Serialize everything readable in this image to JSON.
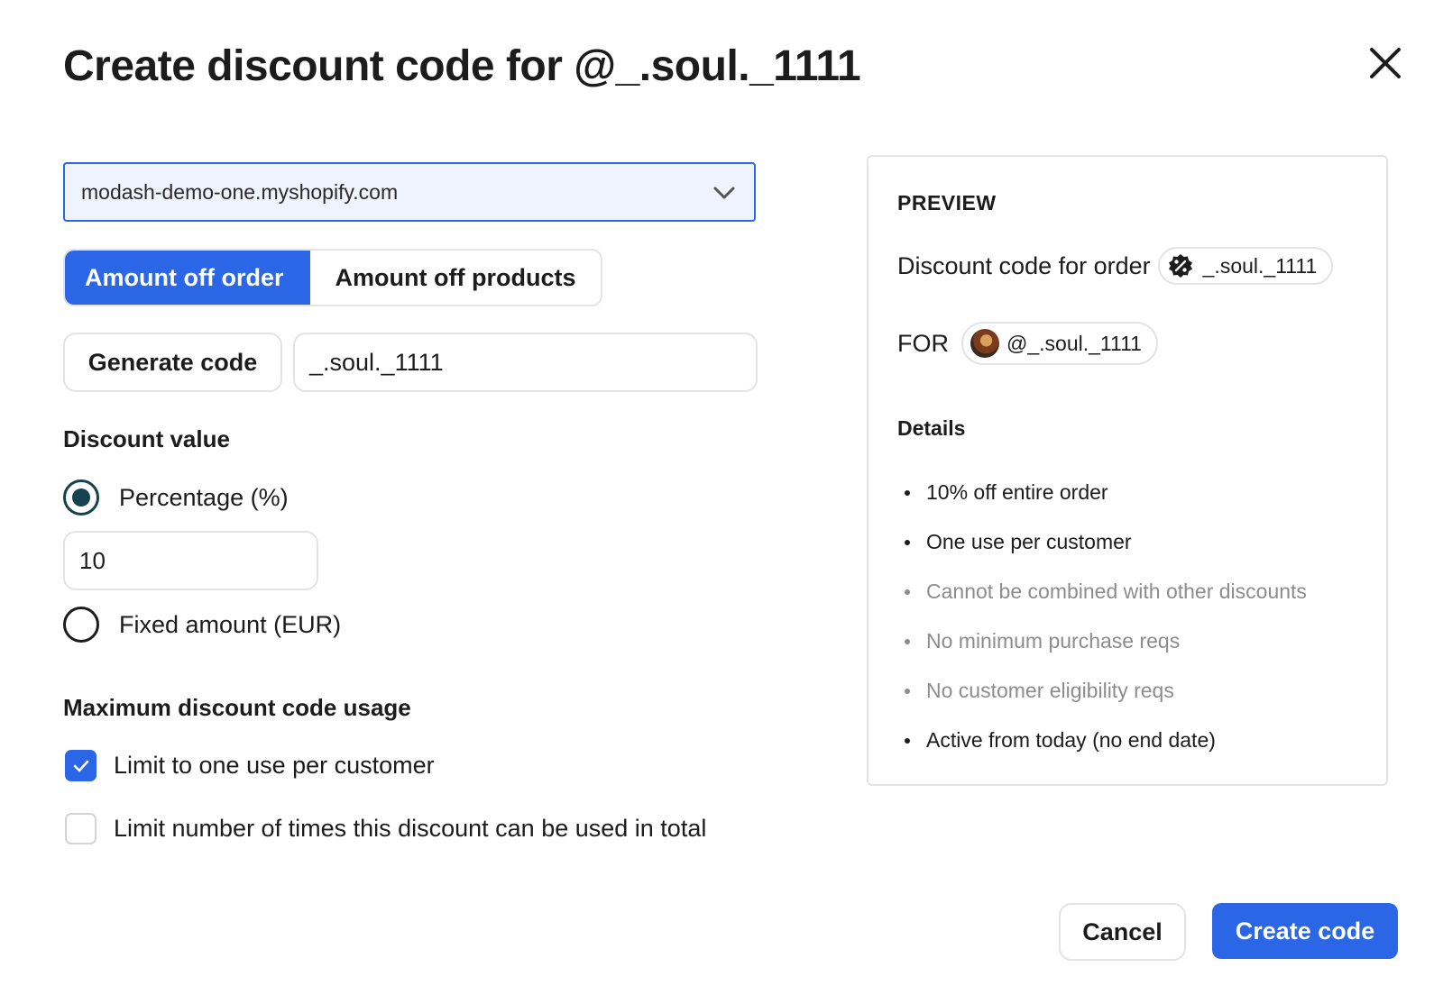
{
  "modal": {
    "title": "Create discount code for @_.soul._1111",
    "close_icon": "close-icon"
  },
  "store_select": {
    "value": "modash-demo-one.myshopify.com",
    "icon": "chevron-down-icon"
  },
  "discount_type_tabs": [
    {
      "label": "Amount off order",
      "selected": true
    },
    {
      "label": "Amount off products",
      "selected": false
    }
  ],
  "code": {
    "generate_label": "Generate code",
    "value": "_.soul._1111"
  },
  "discount_value": {
    "heading": "Discount value",
    "percentage_label": "Percentage (%)",
    "percentage_selected": true,
    "percentage_value": "10",
    "fixed_label": "Fixed amount (EUR)",
    "fixed_selected": false
  },
  "usage": {
    "heading": "Maximum discount code usage",
    "one_per_customer_label": "Limit to one use per customer",
    "one_per_customer_checked": true,
    "total_limit_label": "Limit number of times this discount can be used in total",
    "total_limit_checked": false
  },
  "preview": {
    "heading": "PREVIEW",
    "code_label": "Discount code for order",
    "code_chip": "_.soul._1111",
    "code_chip_icon": "discount-badge-icon",
    "for_label": "FOR",
    "for_chip": "@_.soul._1111",
    "details_heading": "Details",
    "details": [
      {
        "text": "10% off entire order",
        "muted": false
      },
      {
        "text": "One use per customer",
        "muted": false
      },
      {
        "text": "Cannot be combined with other discounts",
        "muted": true
      },
      {
        "text": "No minimum purchase reqs",
        "muted": true
      },
      {
        "text": "No customer eligibility reqs",
        "muted": true
      },
      {
        "text": "Active from today (no end date)",
        "muted": false
      }
    ]
  },
  "footer": {
    "cancel_label": "Cancel",
    "create_label": "Create code"
  },
  "colors": {
    "accent": "#2b66e6",
    "radio_selected": "#16424f",
    "muted_text": "#8c8c8c",
    "border": "#e3e3e3"
  }
}
